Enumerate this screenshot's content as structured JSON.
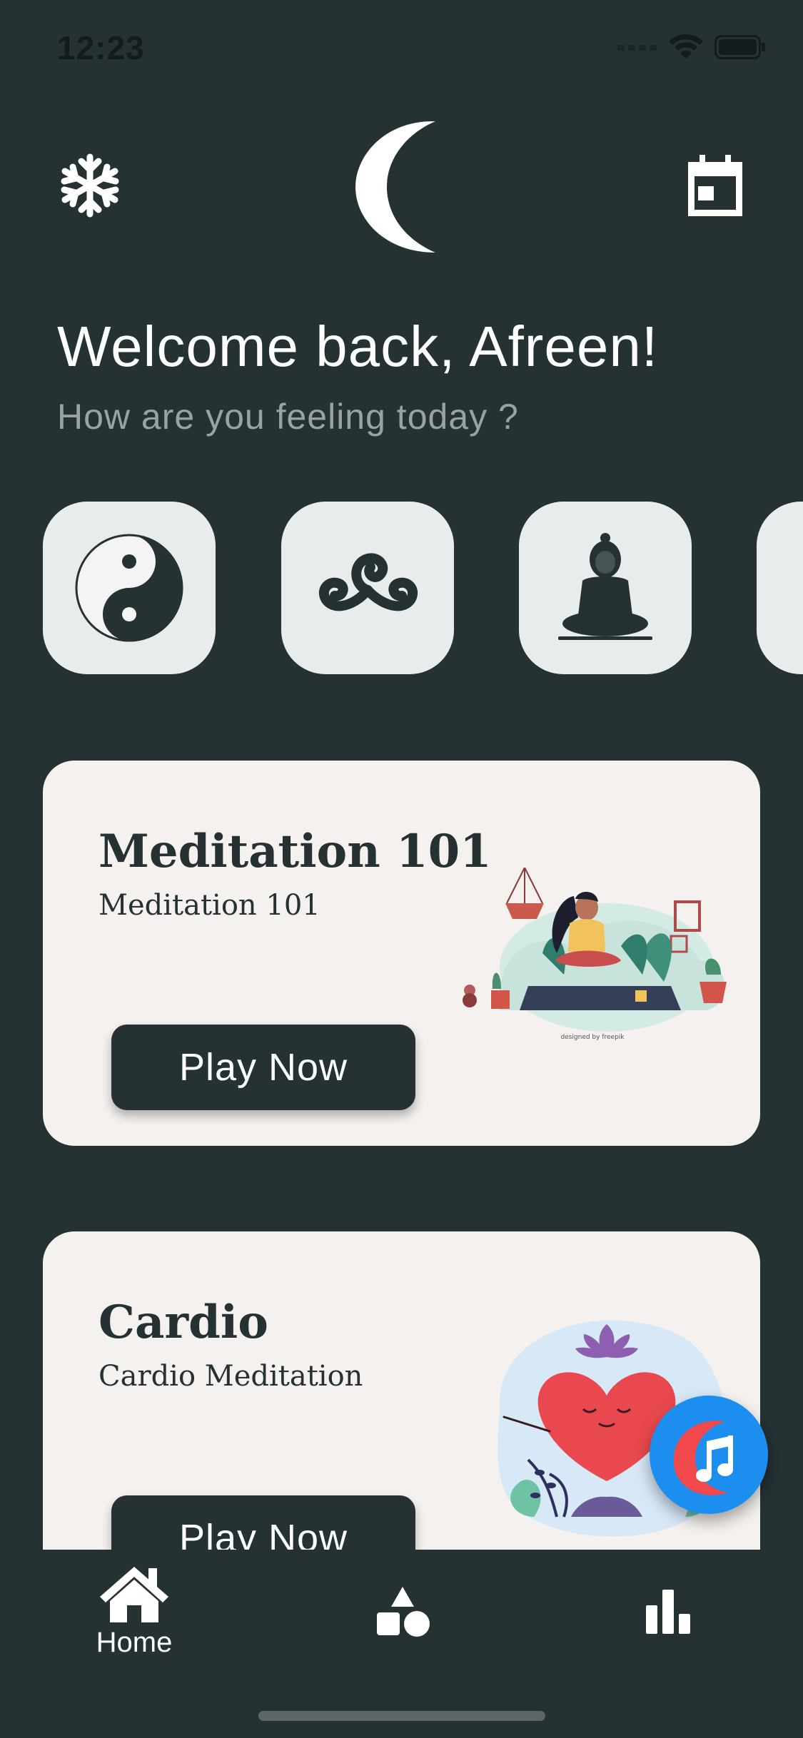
{
  "status_bar": {
    "time": "12:23"
  },
  "header": {
    "left_icon": "snowflake-icon",
    "logo_icon": "crescent-moon-icon",
    "right_icon": "calendar-icon"
  },
  "welcome": {
    "title": "Welcome back, Afreen!",
    "subtitle": "How are you feeling today ?"
  },
  "moods": [
    {
      "icon": "yin-yang-icon"
    },
    {
      "icon": "triskelion-icon"
    },
    {
      "icon": "buddha-icon"
    },
    {
      "icon": "partial-mood-icon"
    }
  ],
  "cards": [
    {
      "title": "Meditation 101",
      "subtitle": "Meditation 101",
      "button": "Play Now",
      "illustration": "meditation-woman-illustration",
      "credit": "designed by freepik"
    },
    {
      "title": "Cardio",
      "subtitle": "Cardio Meditation",
      "button": "Play Now",
      "illustration": "heart-lotus-illustration"
    }
  ],
  "fab": {
    "icon": "music-moon-icon"
  },
  "bottom_nav": [
    {
      "label": "Home",
      "icon": "home-icon",
      "active": true
    },
    {
      "label": "",
      "icon": "shapes-icon",
      "active": false
    },
    {
      "label": "",
      "icon": "bar-chart-icon",
      "active": false
    }
  ],
  "colors": {
    "background": "#253133",
    "card": "#f4f1ee",
    "mood_tile": "#e9ecec",
    "accent": "#1b8ef0",
    "muted_text": "#9aa3a4"
  }
}
